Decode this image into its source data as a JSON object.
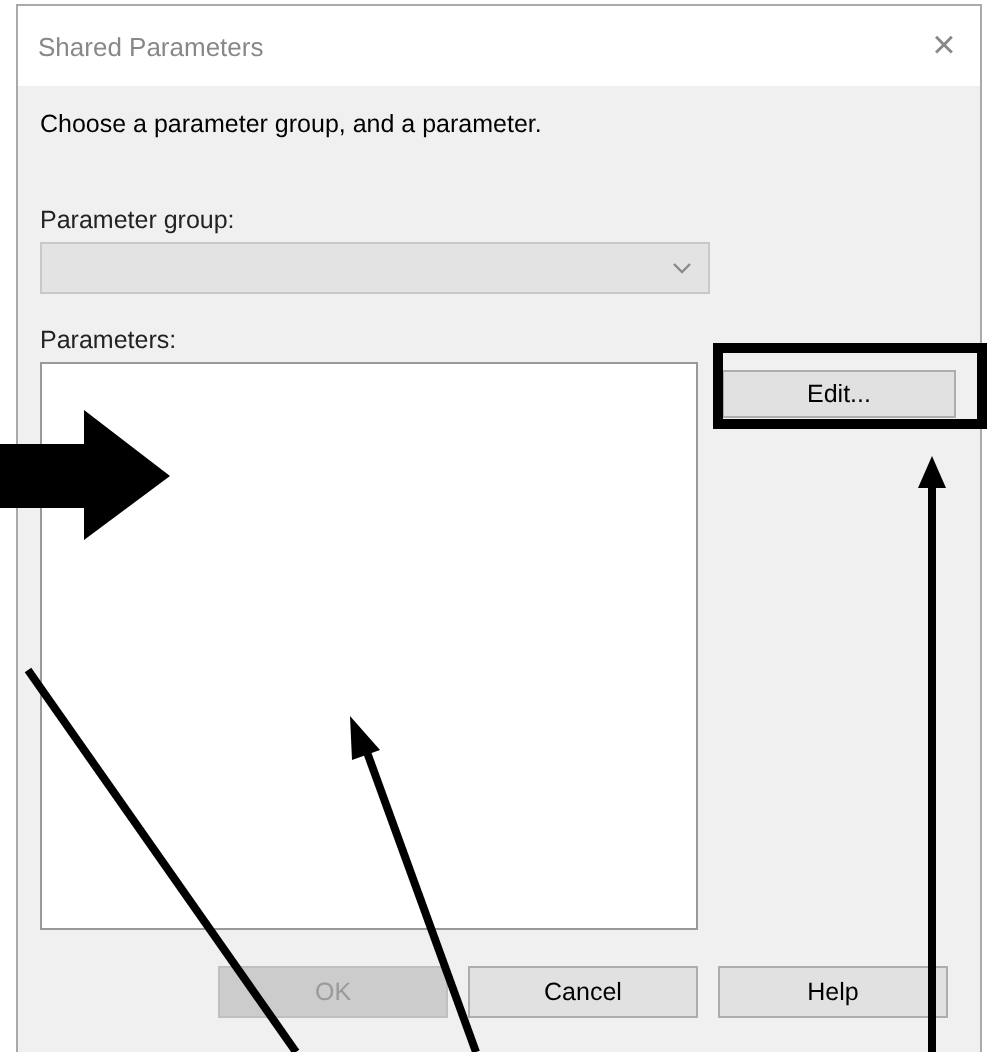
{
  "window": {
    "title": "Shared Parameters",
    "close": "×"
  },
  "instruction": "Choose a parameter group, and a parameter.",
  "parameter_group": {
    "label": "Parameter group:",
    "disabled": true
  },
  "parameters": {
    "label": "Parameters:"
  },
  "side_buttons": [
    {
      "label": "Edit...",
      "disabled": false
    }
  ],
  "buttons": [
    {
      "label": "OK",
      "disabled": true
    },
    {
      "label": "Cancel",
      "disabled": false
    },
    {
      "label": "Help",
      "disabled": false
    }
  ]
}
